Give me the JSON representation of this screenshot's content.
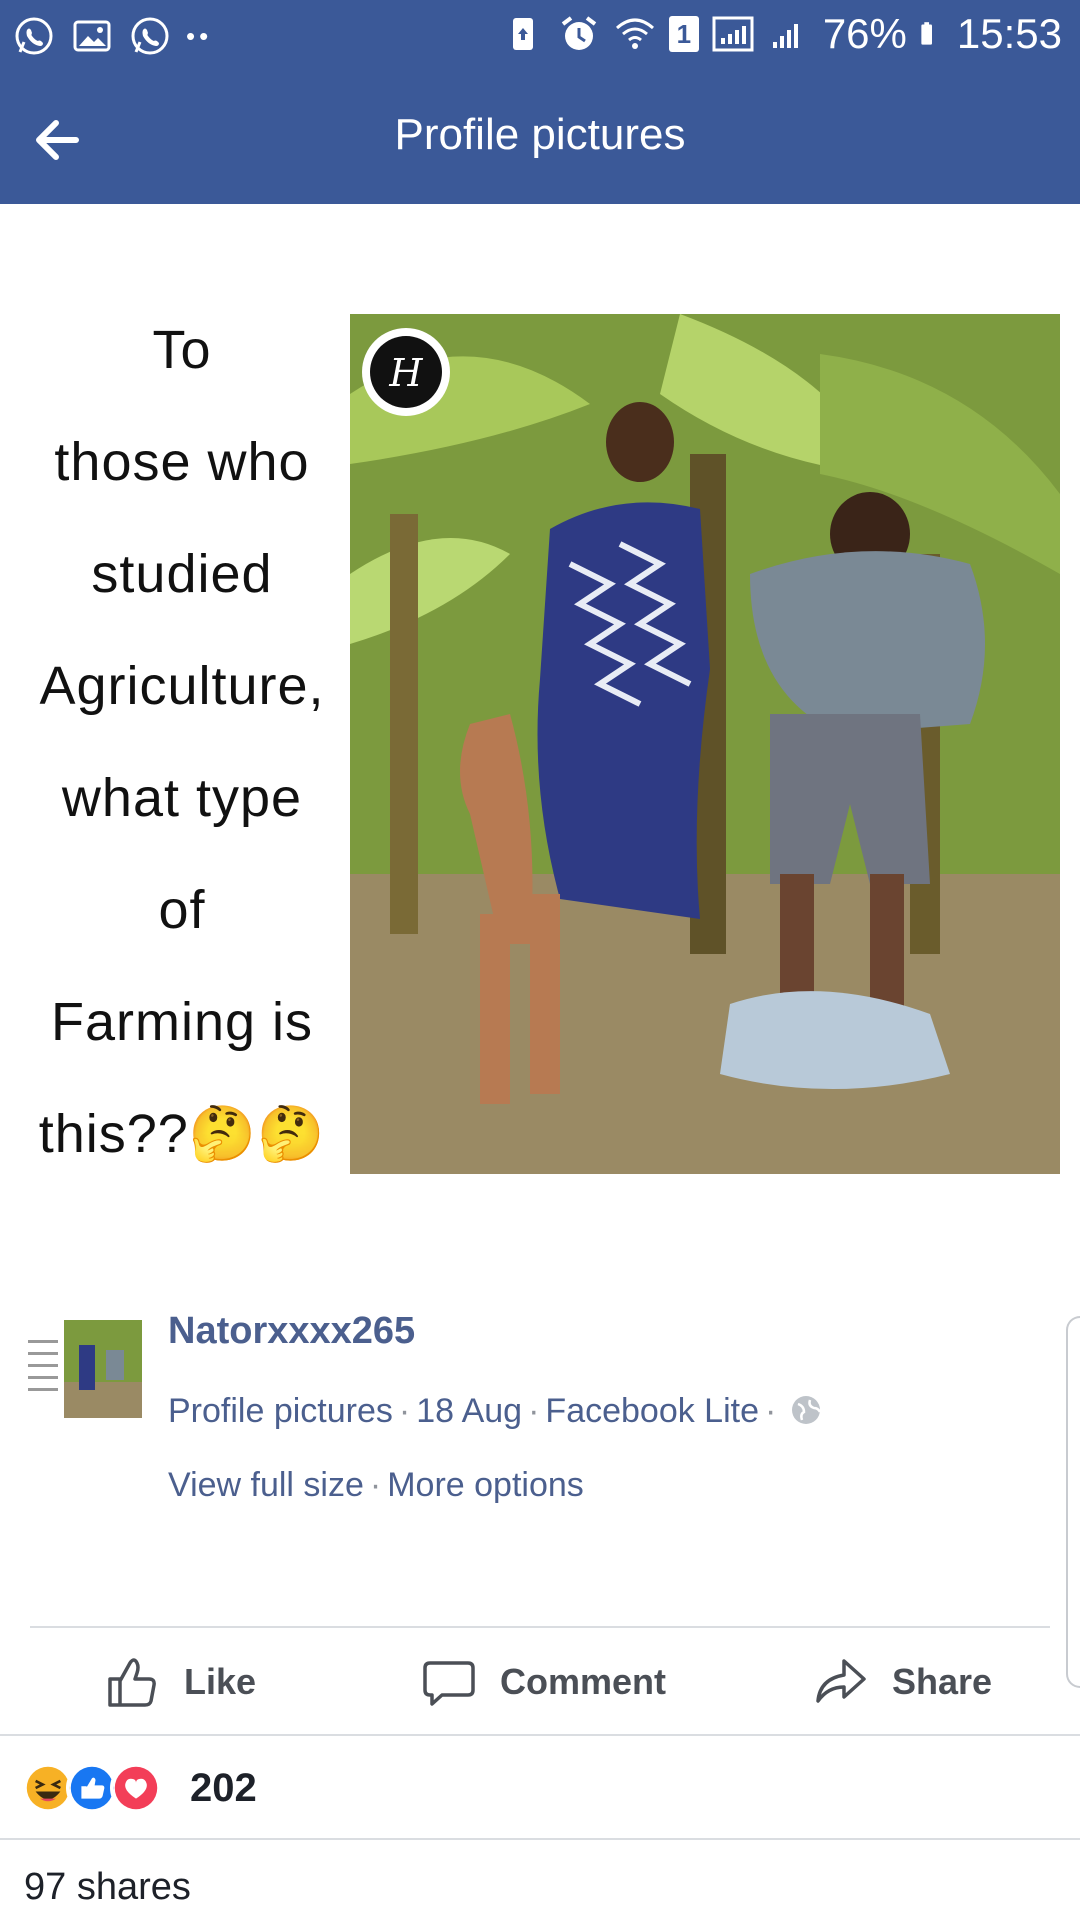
{
  "status_bar": {
    "battery": "76%",
    "time": "15:53",
    "sim_slot": "1"
  },
  "header": {
    "title": "Profile pictures",
    "back_icon": "arrow-left-icon"
  },
  "meme": {
    "lines": [
      "To",
      "those who",
      "studied",
      "Agriculture,",
      "what type",
      "of",
      "Farming is",
      "this??🤔🤔"
    ]
  },
  "post": {
    "author": "Natorxxxx265",
    "album": "Profile pictures",
    "date": "18 Aug",
    "source": "Facebook Lite",
    "privacy_icon": "globe-icon",
    "view_full_size": "View full size",
    "more_options": "More options"
  },
  "actions": {
    "like": "Like",
    "comment": "Comment",
    "share": "Share"
  },
  "reactions": {
    "types": [
      "haha",
      "like",
      "love"
    ],
    "count": "202"
  },
  "shares_text": "97 shares",
  "colors": {
    "brand": "#3b5998",
    "link": "#4b5f8e",
    "like_blue": "#1877f2",
    "love_red": "#f33e58",
    "haha_yellow": "#f7b125"
  }
}
